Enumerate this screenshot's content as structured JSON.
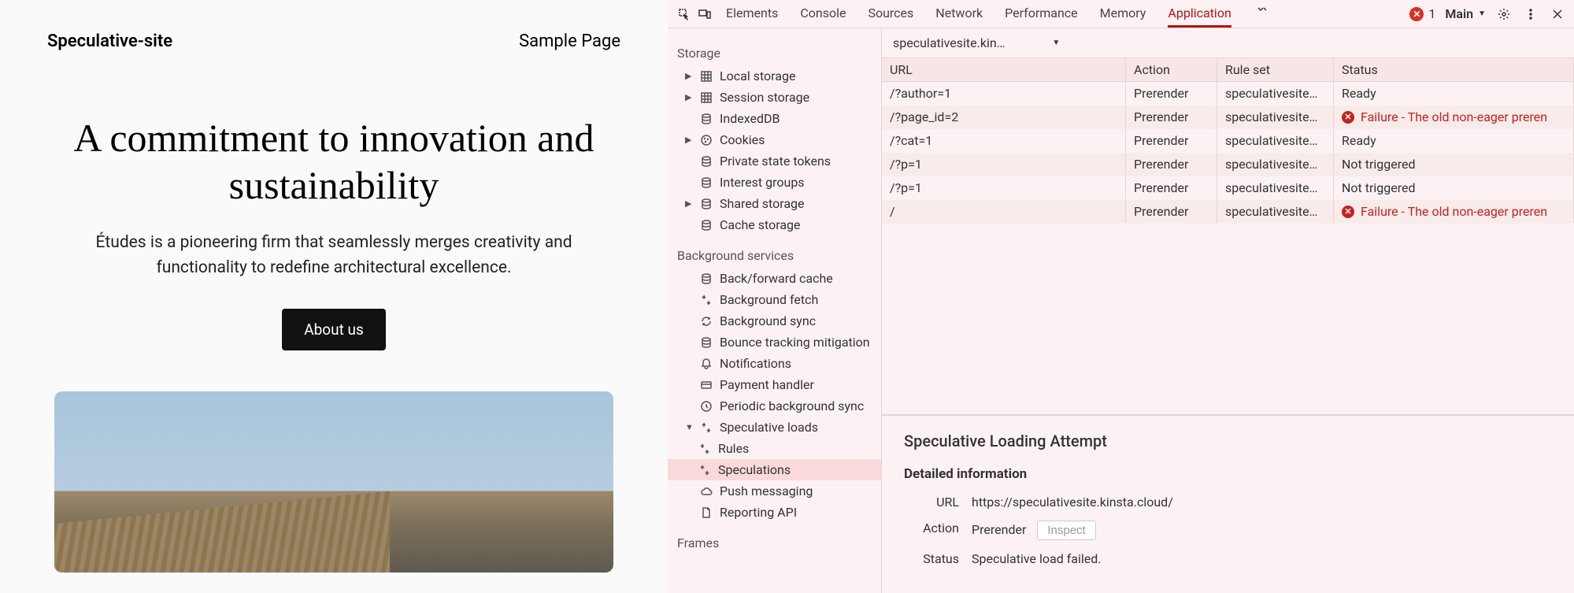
{
  "site": {
    "title": "Speculative-site",
    "nav": "Sample Page",
    "heading": "A commitment to innovation and sustainability",
    "subheading": "Études is a pioneering firm that seamlessly merges creativity and functionality to redefine architectural excellence.",
    "cta": "About us"
  },
  "devtools": {
    "tabs": [
      "Elements",
      "Console",
      "Sources",
      "Network",
      "Performance",
      "Memory",
      "Application"
    ],
    "active_tab": "Application",
    "error_count": "1",
    "target": "Main",
    "origin": "speculativesite.kin…",
    "sidebar": {
      "storage_title": "Storage",
      "storage": [
        "Local storage",
        "Session storage",
        "IndexedDB",
        "Cookies",
        "Private state tokens",
        "Interest groups",
        "Shared storage",
        "Cache storage"
      ],
      "bg_title": "Background services",
      "bg": [
        "Back/forward cache",
        "Background fetch",
        "Background sync",
        "Bounce tracking mitigation",
        "Notifications",
        "Payment handler",
        "Periodic background sync",
        "Speculative loads",
        "Push messaging",
        "Reporting API"
      ],
      "spec_children": [
        "Rules",
        "Speculations"
      ],
      "frames_title": "Frames"
    },
    "table": {
      "headers": [
        "URL",
        "Action",
        "Rule set",
        "Status"
      ],
      "rows": [
        {
          "url": "/?author=1",
          "action": "Prerender",
          "ruleset": "speculativesite…",
          "status": "Ready",
          "fail": false
        },
        {
          "url": "/?page_id=2",
          "action": "Prerender",
          "ruleset": "speculativesite…",
          "status": "Failure - The old non-eager preren",
          "fail": true
        },
        {
          "url": "/?cat=1",
          "action": "Prerender",
          "ruleset": "speculativesite…",
          "status": "Ready",
          "fail": false
        },
        {
          "url": "/?p=1",
          "action": "Prerender",
          "ruleset": "speculativesite…",
          "status": "Not triggered",
          "fail": false
        },
        {
          "url": "/?p=1",
          "action": "Prerender",
          "ruleset": "speculativesite…",
          "status": "Not triggered",
          "fail": false
        },
        {
          "url": "/",
          "action": "Prerender",
          "ruleset": "speculativesite…",
          "status": "Failure - The old non-eager preren",
          "fail": true
        }
      ]
    },
    "detail": {
      "title": "Speculative Loading Attempt",
      "section": "Detailed information",
      "url_label": "URL",
      "url": "https://speculativesite.kinsta.cloud/",
      "action_label": "Action",
      "action": "Prerender",
      "inspect": "Inspect",
      "status_label": "Status",
      "status": "Speculative load failed."
    }
  }
}
